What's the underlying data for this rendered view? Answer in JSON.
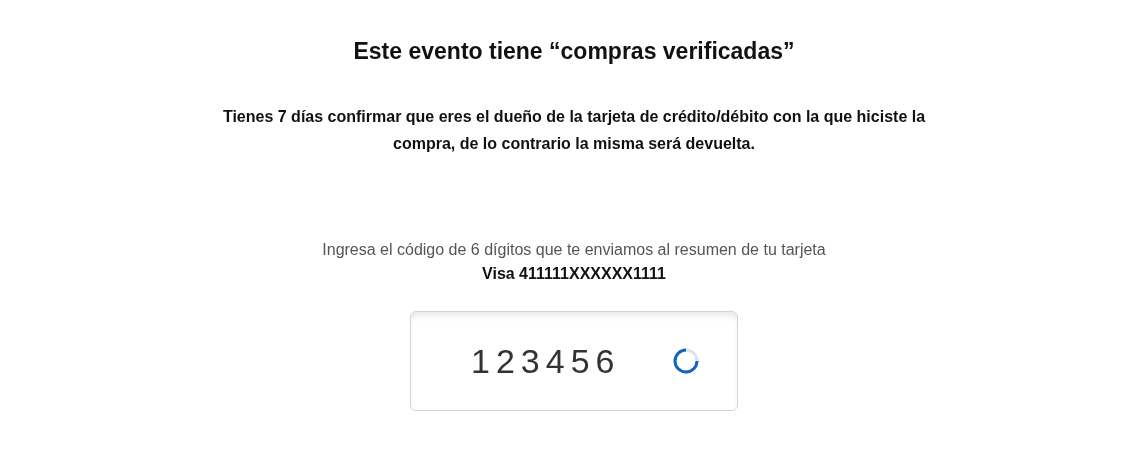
{
  "title": "Este evento tiene “compras verificadas”",
  "notice": "Tienes 7 días confirmar que eres el dueño de la tarjeta de crédito/débito con la que hiciste la compra, de lo contrario la misma será devuelta.",
  "instruction": "Ingresa el código de 6 dígitos que te enviamos al resumen de tu tarjeta",
  "card": "Visa 411111XXXXXX1111",
  "code_field": {
    "value": "123456",
    "loading": true
  }
}
